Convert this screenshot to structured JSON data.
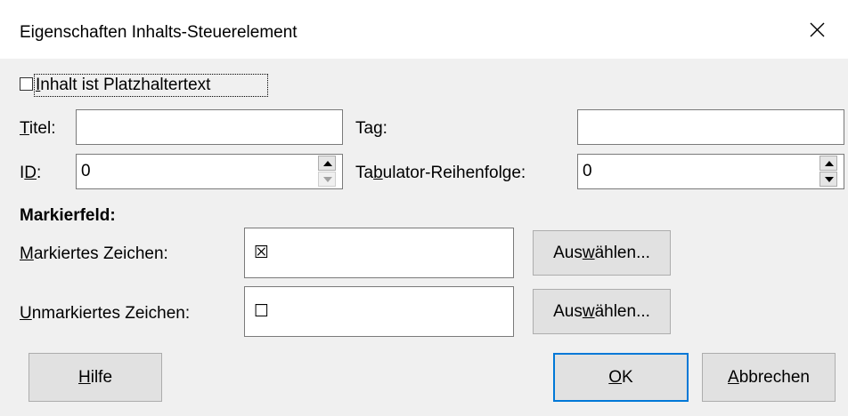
{
  "window": {
    "title": "Eigenschaften Inhalts-Steuerelement",
    "close_glyph": "✕"
  },
  "placeholder_checkbox": {
    "label_first": "I",
    "label_rest": "nhalt ist Platzhaltertext",
    "checked": false
  },
  "fields": {
    "title_label_u": "T",
    "title_label_rest": "itel:",
    "title_value": "",
    "tag_label_a": "Ta",
    "tag_label_u": "g",
    "tag_label_rest": ":",
    "tag_value": "",
    "id_label_a": "I",
    "id_label_u": "D",
    "id_label_rest": ":",
    "id_value": "0",
    "tab_label_a": "Ta",
    "tab_label_u": "b",
    "tab_label_rest": "ulator-Reihenfolge:",
    "tab_value": "0"
  },
  "checkbox_section": {
    "heading": "Markierfeld:",
    "checked_label_u": "M",
    "checked_label_rest": "arkiertes Zeichen:",
    "checked_char": "☒",
    "unchecked_label_u": "U",
    "unchecked_label_rest": "nmarkiertes Zeichen:",
    "unchecked_char": "☐",
    "select_a": "Aus",
    "select_u": "w",
    "select_rest": "ählen..."
  },
  "buttons": {
    "help_u": "H",
    "help_rest": "ilfe",
    "ok_u": "O",
    "ok_rest": "K",
    "cancel_u": "A",
    "cancel_rest": "bbrechen"
  },
  "colors": {
    "accent": "#0078d7",
    "dialog_bg": "#f0f0f0"
  }
}
